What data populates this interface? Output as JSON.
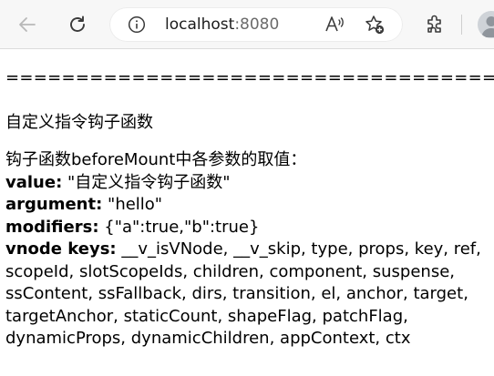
{
  "browser": {
    "url_host": "localhost",
    "url_port": ":8080"
  },
  "page": {
    "separator": "==================================================================",
    "heading": "自定义指令钩子函数",
    "intro": "钩子函数beforeMount中各参数的取值：",
    "fields": [
      {
        "label": "value:",
        "value": " \"自定义指令钩子函数\""
      },
      {
        "label": "argument:",
        "value": " \"hello\""
      },
      {
        "label": "modifiers:",
        "value": " {\"a\":true,\"b\":true}"
      },
      {
        "label": "vnode keys:",
        "value": " __v_isVNode, __v_skip, type, props, key, ref,"
      }
    ],
    "vnode_keys_cont": [
      "scopeId, slotScopeIds, children, component, suspense,",
      "ssContent, ssFallback, dirs, transition, el, anchor, target,",
      "targetAnchor, staticCount, shapeFlag, patchFlag,",
      "dynamicProps, dynamicChildren, appContext, ctx"
    ]
  }
}
